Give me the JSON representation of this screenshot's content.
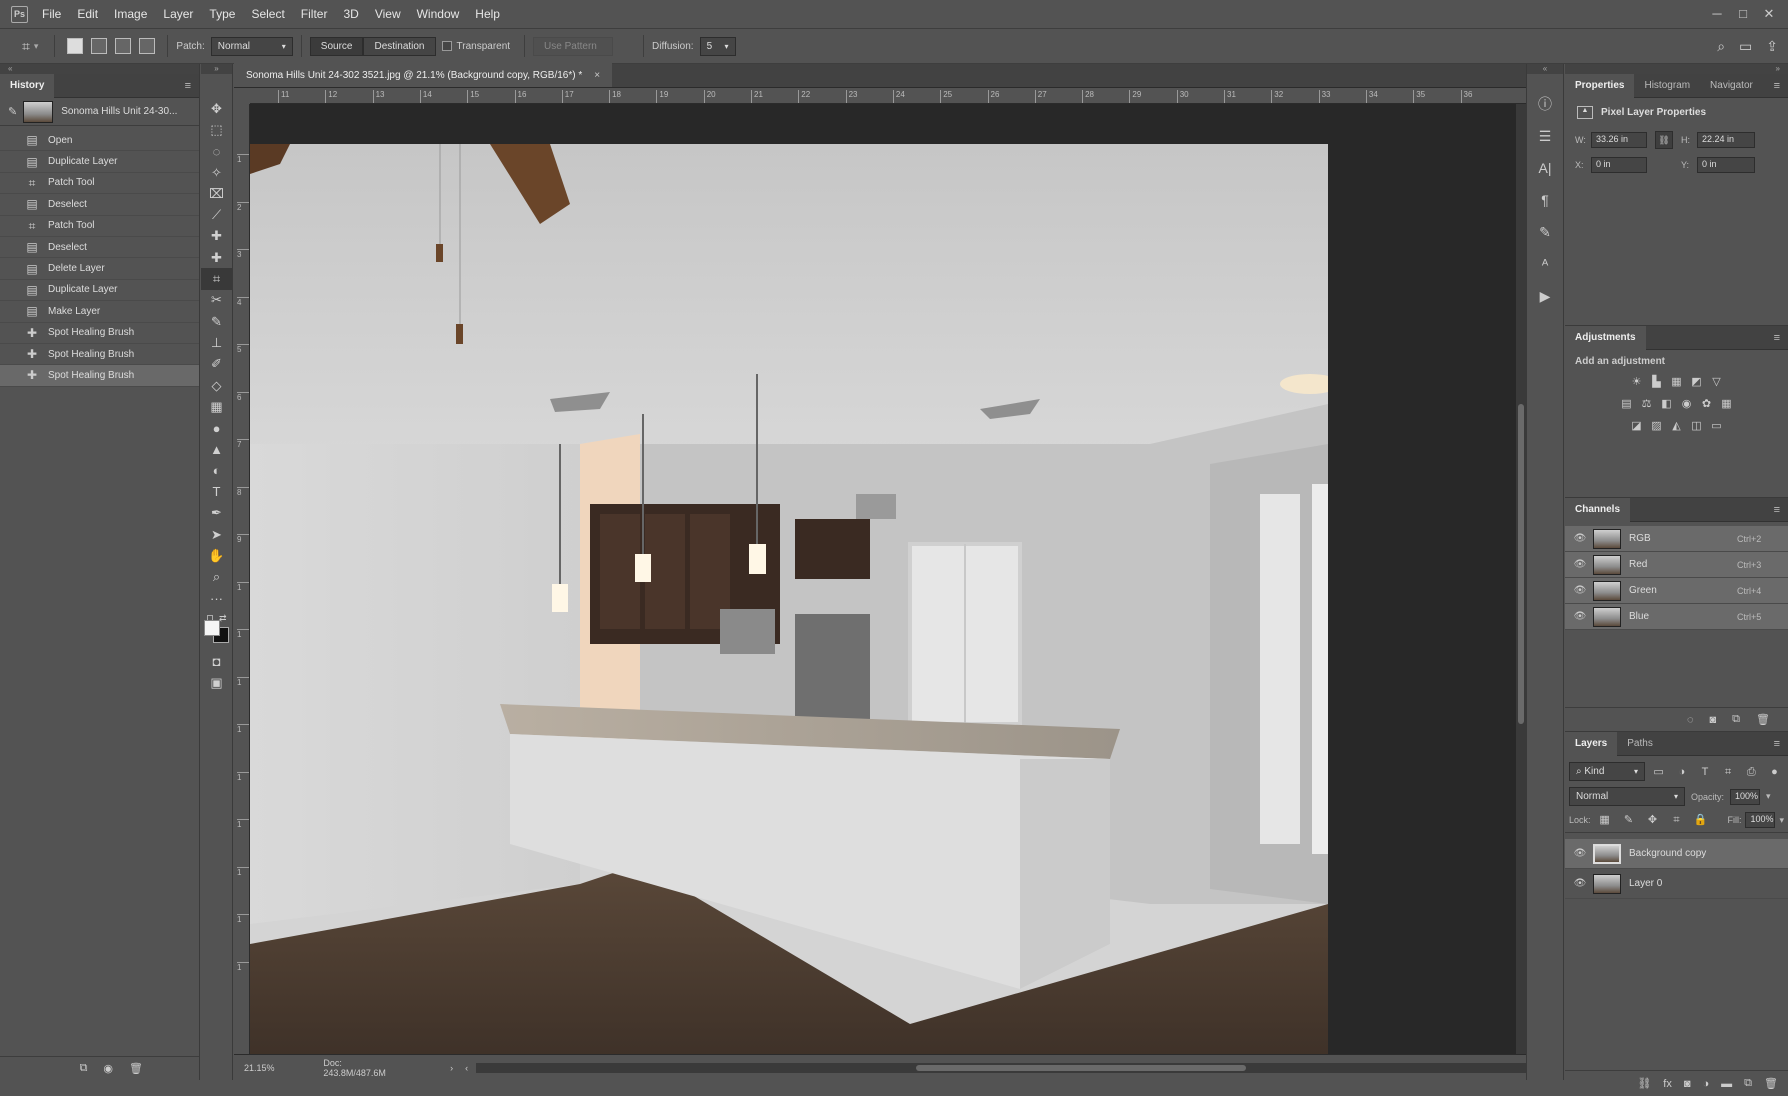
{
  "menubar": {
    "logo": "Ps",
    "items": [
      "File",
      "Edit",
      "Image",
      "Layer",
      "Type",
      "Select",
      "Filter",
      "3D",
      "View",
      "Window",
      "Help"
    ],
    "min": "─",
    "max": "□",
    "close": "✕"
  },
  "options": {
    "patch_label": "Patch:",
    "patch_mode": "Normal",
    "source": "Source",
    "destination": "Destination",
    "transparent": "Transparent",
    "use_pattern": "Use Pattern",
    "diffusion_label": "Diffusion:",
    "diffusion_value": "5"
  },
  "history": {
    "tab": "History",
    "snapshot": "Sonoma Hills Unit 24-30...",
    "items": [
      "Open",
      "Duplicate Layer",
      "Patch Tool",
      "Deselect",
      "Patch Tool",
      "Deselect",
      "Delete Layer",
      "Duplicate Layer",
      "Make Layer",
      "Spot Healing Brush",
      "Spot Healing Brush",
      "Spot Healing Brush"
    ]
  },
  "doc": {
    "tab_title": "Sonoma Hills Unit 24-302 3521.jpg @ 21.1% (Background copy, RGB/16*) *",
    "close": "×",
    "ruler_h": [
      "11",
      "12",
      "13",
      "14",
      "15",
      "16",
      "17",
      "18",
      "19",
      "20",
      "21",
      "22",
      "23",
      "24",
      "25",
      "26",
      "27",
      "28",
      "29",
      "30",
      "31",
      "32",
      "33",
      "34",
      "35",
      "36"
    ],
    "ruler_v": [
      "1",
      "2",
      "3",
      "4",
      "5",
      "6",
      "7",
      "8",
      "9",
      "1",
      "1",
      "1",
      "1",
      "1",
      "1",
      "1",
      "1",
      "1"
    ]
  },
  "status": {
    "zoom": "21.15%",
    "doc": "Doc: 243.8M/487.6M"
  },
  "properties": {
    "tabs": [
      "Properties",
      "Histogram",
      "Navigator"
    ],
    "title": "Pixel Layer Properties",
    "w_label": "W:",
    "w": "33.26 in",
    "h_label": "H:",
    "h": "22.24 in",
    "x_label": "X:",
    "x": "0 in",
    "y_label": "Y:",
    "y": "0 in"
  },
  "adjustments": {
    "tab": "Adjustments",
    "subtitle": "Add an adjustment"
  },
  "channels": {
    "tab": "Channels",
    "rows": [
      {
        "name": "RGB",
        "key": "Ctrl+2"
      },
      {
        "name": "Red",
        "key": "Ctrl+3"
      },
      {
        "name": "Green",
        "key": "Ctrl+4"
      },
      {
        "name": "Blue",
        "key": "Ctrl+5"
      }
    ]
  },
  "layers": {
    "tabs": [
      "Layers",
      "Paths"
    ],
    "kind": "Kind",
    "blend": "Normal",
    "opacity_label": "Opacity:",
    "opacity": "100%",
    "lock_label": "Lock:",
    "fill_label": "Fill:",
    "fill": "100%",
    "rows": [
      "Background copy",
      "Layer 0"
    ]
  }
}
